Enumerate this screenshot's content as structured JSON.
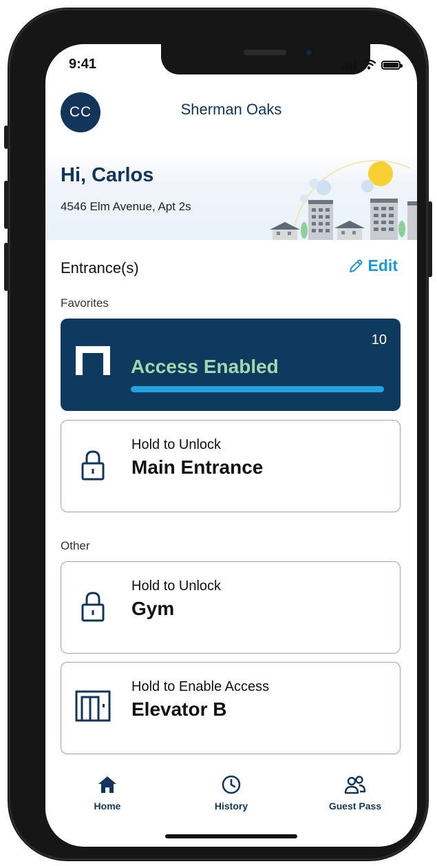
{
  "status_bar": {
    "time": "9:41"
  },
  "header": {
    "avatar_initials": "CC",
    "building_name": "Sherman Oaks"
  },
  "hero": {
    "greeting": "Hi, Carlos",
    "address": "4546 Elm Avenue, Apt 2s"
  },
  "entrances": {
    "title": "Entrance(s)",
    "edit_label": "Edit",
    "favorites_label": "Favorites",
    "other_label": "Other",
    "active_card": {
      "status": "Access Enabled",
      "countdown": "10",
      "progress": 1.0,
      "icon": "door-open-icon"
    },
    "favorites": [
      {
        "hint": "Hold to Unlock",
        "name": "Main Entrance",
        "icon": "lock-icon"
      }
    ],
    "other": [
      {
        "hint": "Hold to Unlock",
        "name": "Gym",
        "icon": "lock-icon"
      },
      {
        "hint": "Hold to Enable Access",
        "name": "Elevator B",
        "icon": "elevator-icon"
      }
    ]
  },
  "tabs": [
    {
      "label": "Home",
      "icon": "home-icon",
      "active": true
    },
    {
      "label": "History",
      "icon": "clock-icon",
      "active": false
    },
    {
      "label": "Guest Pass",
      "icon": "people-icon",
      "active": false
    }
  ],
  "colors": {
    "navy": "#123559",
    "card_active_bg": "#0f3a5f",
    "accent_blue": "#1a98d5",
    "access_green": "#a4d7ae",
    "progress": "#22a3df"
  }
}
